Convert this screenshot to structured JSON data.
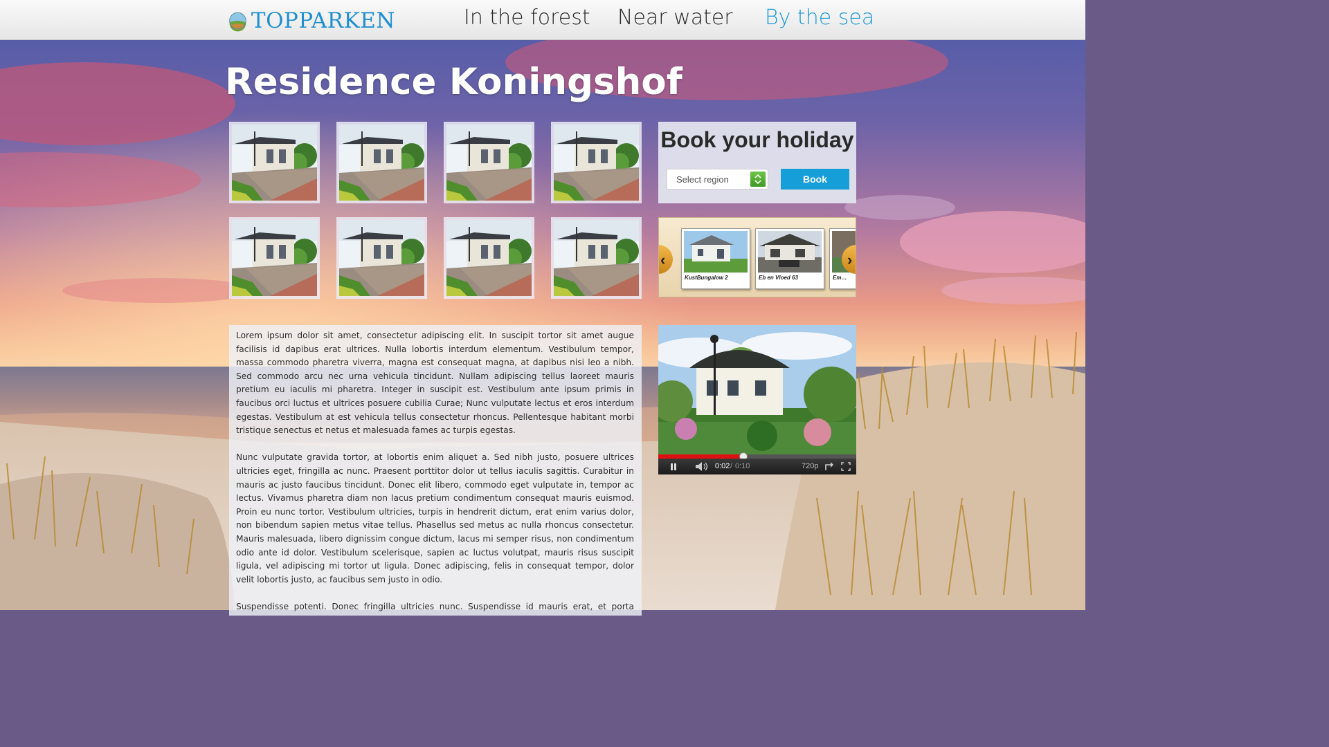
{
  "header": {
    "logo_text": "TOPPARKEN",
    "nav": [
      {
        "label": "In the forest",
        "active": false
      },
      {
        "label": "Near water",
        "active": false
      },
      {
        "label": "By the sea",
        "active": true
      }
    ]
  },
  "page": {
    "title": "Residence Koningshof"
  },
  "gallery": {
    "thumbnails": 8
  },
  "booking": {
    "title": "Book your holiday",
    "region_placeholder": "Select region",
    "book_label": "Book"
  },
  "carousel": {
    "items": [
      {
        "caption": "KustBungalow 2"
      },
      {
        "caption": "Eb en Vloed 63"
      },
      {
        "caption": "Em…"
      }
    ]
  },
  "description": {
    "paragraphs": [
      "Lorem ipsum dolor sit amet, consectetur adipiscing elit. In suscipit tortor sit amet augue facilisis id dapibus erat ultrices. Nulla lobortis interdum elementum. Vestibulum tempor, massa commodo pharetra viverra, magna est consequat magna, at dapibus nisi leo a nibh. Sed commodo arcu nec urna vehicula tincidunt. Nullam adipiscing tellus laoreet mauris pretium eu iaculis mi pharetra. Integer in suscipit est. Vestibulum ante ipsum primis in faucibus orci luctus et ultrices posuere cubilia Curae; Nunc vulputate lectus et eros interdum egestas. Vestibulum at est vehicula tellus consectetur rhoncus. Pellentesque habitant morbi tristique senectus et netus et malesuada fames ac turpis egestas.",
      "Nunc vulputate gravida tortor, at lobortis enim aliquet a. Sed nibh justo, posuere ultrices ultricies eget, fringilla ac nunc. Praesent porttitor dolor ut tellus iaculis sagittis. Curabitur in mauris ac justo faucibus tincidunt. Donec elit libero, commodo eget vulputate in, tempor ac lectus. Vivamus pharetra diam non lacus pretium condimentum consequat mauris euismod. Proin eu nunc tortor. Vestibulum ultricies, turpis in hendrerit dictum, erat enim varius dolor, non bibendum sapien metus vitae tellus. Phasellus sed metus ac nulla rhoncus consectetur. Mauris malesuada, libero dignissim congue dictum, lacus mi semper risus, non condimentum odio ante id dolor. Vestibulum scelerisque, sapien ac luctus volutpat, mauris risus suscipit ligula, vel adipiscing mi tortor ut ligula. Donec adipiscing, felis in consequat tempor, dolor velit lobortis justo, ac faucibus sem justo in odio.",
      "Suspendisse potenti. Donec fringilla ultricies nunc. Suspendisse id mauris erat, et porta turpis. Nunc accumsan malesuada enim, faucibus rhoncus neque scelerisque non. Etiam vel semper ante. Lorem ipsum dolor sit amet, consectetur adipiscing elit. Nullam id congue dolor."
    ]
  },
  "video": {
    "current_time": "0:02",
    "separator": "/",
    "duration": "0:10",
    "quality": "720p",
    "progress_fraction": 0.43
  },
  "icons": {
    "logo": "globe-landscape-icon",
    "select_arrow": "updown-arrows-icon",
    "carousel_prev": "chevron-left-icon",
    "carousel_next": "chevron-right-icon",
    "pause": "pause-icon",
    "volume": "speaker-icon",
    "share": "share-arrow-icon",
    "fullscreen": "fullscreen-icon"
  },
  "colors": {
    "accent": "#1b9ad6",
    "book_button": "#169ed8",
    "progress": "#dd1111"
  }
}
